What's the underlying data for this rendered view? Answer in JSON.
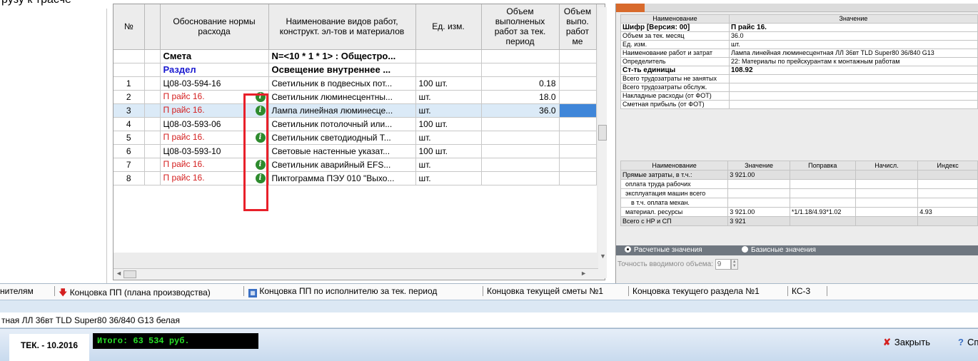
{
  "top_caption": "рузу к трасче",
  "grid": {
    "headers": [
      "№",
      "",
      "Обоснование нормы расхода",
      "Наименование видов работ, конструкт. эл-тов и материалов",
      "Ед. изм.",
      "Объем выполненых работ за тек. период",
      "Объем выпо. работ ме"
    ],
    "rows": [
      {
        "n": "",
        "code": "Смета",
        "name": "N=<10 * 1 * 1> : Общестро...",
        "unit": "",
        "vol": "",
        "info": false
      },
      {
        "n": "",
        "code": "Раздел",
        "name": "Освещение внутреннее ...",
        "unit": "",
        "vol": "",
        "info": false
      },
      {
        "n": "1",
        "code": "Ц08-03-594-16",
        "name": "Светильник в подвесных пот...",
        "unit": "100 шт.",
        "vol": "0.18",
        "info": false
      },
      {
        "n": "2",
        "code": "П райс 16.",
        "name": "Светильник люминесцентны...",
        "unit": "шт.",
        "vol": "18.0",
        "info": true
      },
      {
        "n": "3",
        "code": "П райс 16.",
        "name": "Лампа линейная люминесце...",
        "unit": "шт.",
        "vol": "36.0",
        "info": true
      },
      {
        "n": "4",
        "code": "Ц08-03-593-06",
        "name": "Светильник потолочный или...",
        "unit": "100 шт.",
        "vol": "",
        "info": false
      },
      {
        "n": "5",
        "code": "П райс 16.",
        "name": "Светильник светодиодный Т...",
        "unit": "шт.",
        "vol": "",
        "info": true
      },
      {
        "n": "6",
        "code": "Ц08-03-593-10",
        "name": "Световые настенные указат...",
        "unit": "100 шт.",
        "vol": "",
        "info": false
      },
      {
        "n": "7",
        "code": "П райс 16.",
        "name": "Светильник аварийный EFS...",
        "unit": "шт.",
        "vol": "",
        "info": true
      },
      {
        "n": "8",
        "code": "П райс 16.",
        "name": "Пиктограмма ПЭУ 010 \"Выхо...",
        "unit": "шт.",
        "vol": "",
        "info": true
      }
    ],
    "info_icon": "info-icon"
  },
  "props": {
    "headers": [
      "Наименование",
      "Значение"
    ],
    "rows": [
      {
        "k": "Шифр [Версия:   00]",
        "v": "П райс 16.",
        "bold": true
      },
      {
        "k": "Объем за тек. месяц",
        "v": "36.0",
        "bold": false
      },
      {
        "k": "Ед. изм.",
        "v": "шт.",
        "bold": false
      },
      {
        "k": "Наименование работ и затрат",
        "v": "Лампа линейная люминесцентная ЛЛ 36вт TLD Super80 36/840 G13",
        "bold": false
      },
      {
        "k": "Определитель",
        "v": "22: Материалы по прейскурантам к монтажным работам",
        "bold": false
      },
      {
        "k": "Ст-ть единицы",
        "v": "108.92",
        "bold": true
      },
      {
        "k": "Всего трудозатраты не занятых",
        "v": "",
        "bold": false
      },
      {
        "k": "Всего трудозатраты обслуж.",
        "v": "",
        "bold": false
      },
      {
        "k": "Накладные расходы (от ФОТ)",
        "v": "",
        "bold": false
      },
      {
        "k": "Сметная прибыль (от ФОТ)",
        "v": "",
        "bold": false
      }
    ]
  },
  "costs": {
    "headers": [
      "Наименование",
      "Значение",
      "Поправка",
      "Начисл.",
      "Индекс"
    ],
    "rows": [
      {
        "k": "Прямые затраты, в т.ч.:",
        "v": "3 921.00",
        "p": "",
        "n": "",
        "i": "",
        "gray": true,
        "ind": ""
      },
      {
        "k": "оплата труда рабочих",
        "v": "",
        "p": "",
        "n": "",
        "i": "",
        "gray": false,
        "ind": "ind"
      },
      {
        "k": "эксплуатация машин всего",
        "v": "",
        "p": "",
        "n": "",
        "i": "",
        "gray": false,
        "ind": "ind"
      },
      {
        "k": "в т.ч. оплата механ.",
        "v": "",
        "p": "",
        "n": "",
        "i": "",
        "gray": false,
        "ind": "ind2"
      },
      {
        "k": "материал. ресурсы",
        "v": "3 921.00",
        "p": "*1/1.18/4.93*1.02",
        "n": "",
        "i": "4.93",
        "gray": false,
        "ind": "ind"
      },
      {
        "k": "Всего с НР и СП",
        "v": "3 921",
        "p": "",
        "n": "",
        "i": "",
        "gray": true,
        "ind": ""
      }
    ]
  },
  "radios": {
    "calc": "Расчетные значения",
    "base": "Базисные значения"
  },
  "precision": {
    "label": "Точность вводимого объема:",
    "value": "9"
  },
  "tabs": [
    "нителям",
    "Концовка ПП (плана производства)",
    "Концовка ПП по исполнителю за тек. период",
    "Концовка текущей сметы №1",
    "Концовка текущего раздела №1",
    "КС-3"
  ],
  "status_text": "тная ЛЛ 36вт TLD Super80 36/840 G13 белая",
  "period": "ТЕК. - 10.2016",
  "total": "Итого: 63 534 руб.",
  "close_label": "Закрыть",
  "help_label": "Сп",
  "colors": {
    "accent_red": "#e8202a",
    "total_green": "#28e028",
    "selection": "#3f86d9"
  }
}
